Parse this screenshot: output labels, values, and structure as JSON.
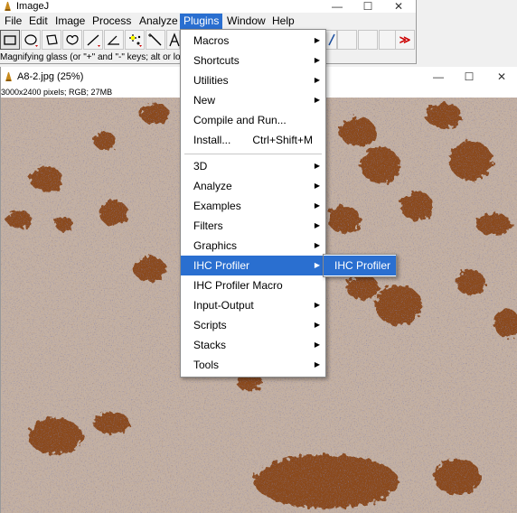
{
  "main_window": {
    "title": "ImageJ",
    "controls": {
      "minimize": "—",
      "maximize": "☐",
      "close": "✕"
    },
    "menus": [
      "File",
      "Edit",
      "Image",
      "Process",
      "Analyze",
      "Plugins",
      "Window",
      "Help"
    ],
    "active_menu": "Plugins",
    "toolbar_tools": [
      "rectangle",
      "oval",
      "polygon",
      "freehand",
      "straight-line",
      "angle",
      "multi-point",
      "wand",
      "text"
    ],
    "overflow_button": "≫",
    "status": "Magnifying glass (or \"+\" and \"-\" keys; alt or lo"
  },
  "image_window": {
    "title": "A8-2.jpg (25%)",
    "info": "3000x2400 pixels; RGB; 27MB",
    "controls": {
      "minimize": "—",
      "maximize": "☐",
      "close": "✕"
    }
  },
  "plugins_menu": {
    "items": [
      {
        "label": "Macros",
        "submenu": true
      },
      {
        "label": "Shortcuts",
        "submenu": true
      },
      {
        "label": "Utilities",
        "submenu": true
      },
      {
        "label": "New",
        "submenu": true
      },
      {
        "label": "Compile and Run...",
        "submenu": false
      },
      {
        "label": "Install...",
        "shortcut": "Ctrl+Shift+M",
        "submenu": false
      },
      {
        "label": "3D",
        "submenu": true
      },
      {
        "label": "Analyze",
        "submenu": true
      },
      {
        "label": "Examples",
        "submenu": true
      },
      {
        "label": "Filters",
        "submenu": true
      },
      {
        "label": "Graphics",
        "submenu": true
      },
      {
        "label": "IHC Profiler",
        "submenu": true,
        "highlighted": true
      },
      {
        "label": "IHC Profiler Macro",
        "submenu": false
      },
      {
        "label": "Input-Output",
        "submenu": true
      },
      {
        "label": "Scripts",
        "submenu": true
      },
      {
        "label": "Stacks",
        "submenu": true
      },
      {
        "label": "Tools",
        "submenu": true
      }
    ],
    "arrow_glyph": "▶",
    "submenu_items": [
      "IHC Profiler"
    ]
  },
  "colors": {
    "highlight": "#2a6fd0",
    "tissue_background": "#c4b1a3",
    "dab_stain": "#8a4a1e",
    "hematoxylin": "#3e3c6e"
  }
}
